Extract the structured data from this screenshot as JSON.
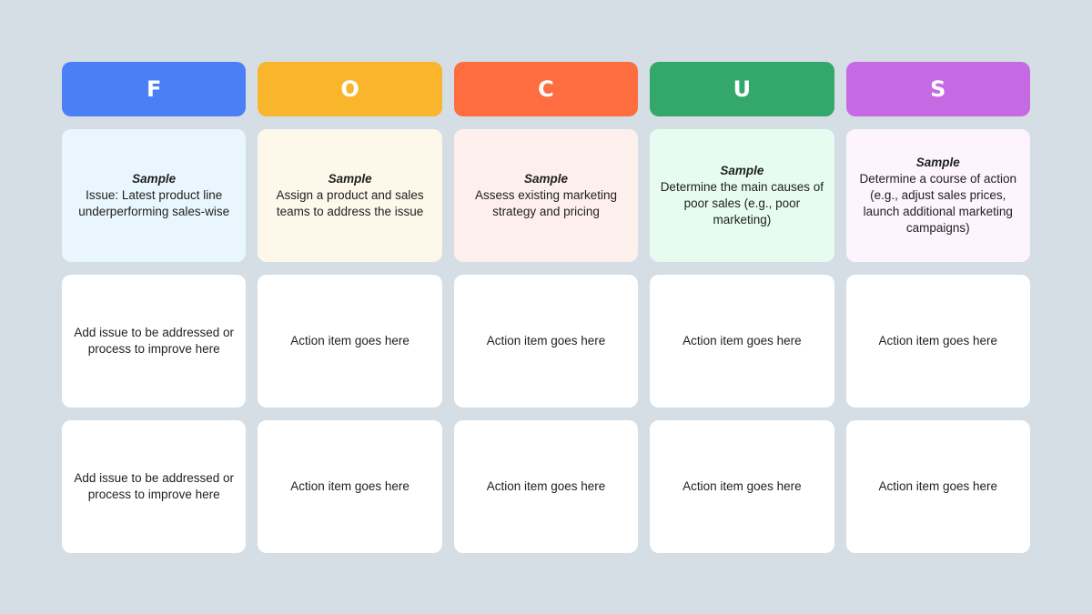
{
  "columns": [
    {
      "letter": "F",
      "header_color": "#4a7ff5",
      "sample_bg": "#e9f6fd",
      "sample_title": "Sample",
      "sample_text": "Issue: Latest product line underperforming sales-wise",
      "rows": [
        "Add issue to be addressed or process to improve here",
        "Add issue to be addressed or process to improve here"
      ]
    },
    {
      "letter": "O",
      "header_color": "#f9b52c",
      "sample_bg": "#fdf8ea",
      "sample_title": "Sample",
      "sample_text": "Assign a product and sales teams to address the issue",
      "rows": [
        "Action item goes here",
        "Action item goes here"
      ]
    },
    {
      "letter": "C",
      "header_color": "#fd6d3f",
      "sample_bg": "#fdf0ec",
      "sample_title": "Sample",
      "sample_text": "Assess existing marketing strategy and pricing",
      "rows": [
        "Action item goes here",
        "Action item goes here"
      ]
    },
    {
      "letter": "U",
      "header_color": "#33a86a",
      "sample_bg": "#e7fcf0",
      "sample_title": "Sample",
      "sample_text": "Determine the main causes of poor sales (e.g., poor marketing)",
      "rows": [
        "Action item goes here",
        "Action item goes here"
      ]
    },
    {
      "letter": "S",
      "header_color": "#c66ae3",
      "sample_bg": "#fdf4fd",
      "sample_title": "Sample",
      "sample_text": "Determine a course of action (e.g., adjust sales prices, launch additional marketing campaigns)",
      "rows": [
        "Action item goes here",
        "Action item goes here"
      ]
    }
  ]
}
